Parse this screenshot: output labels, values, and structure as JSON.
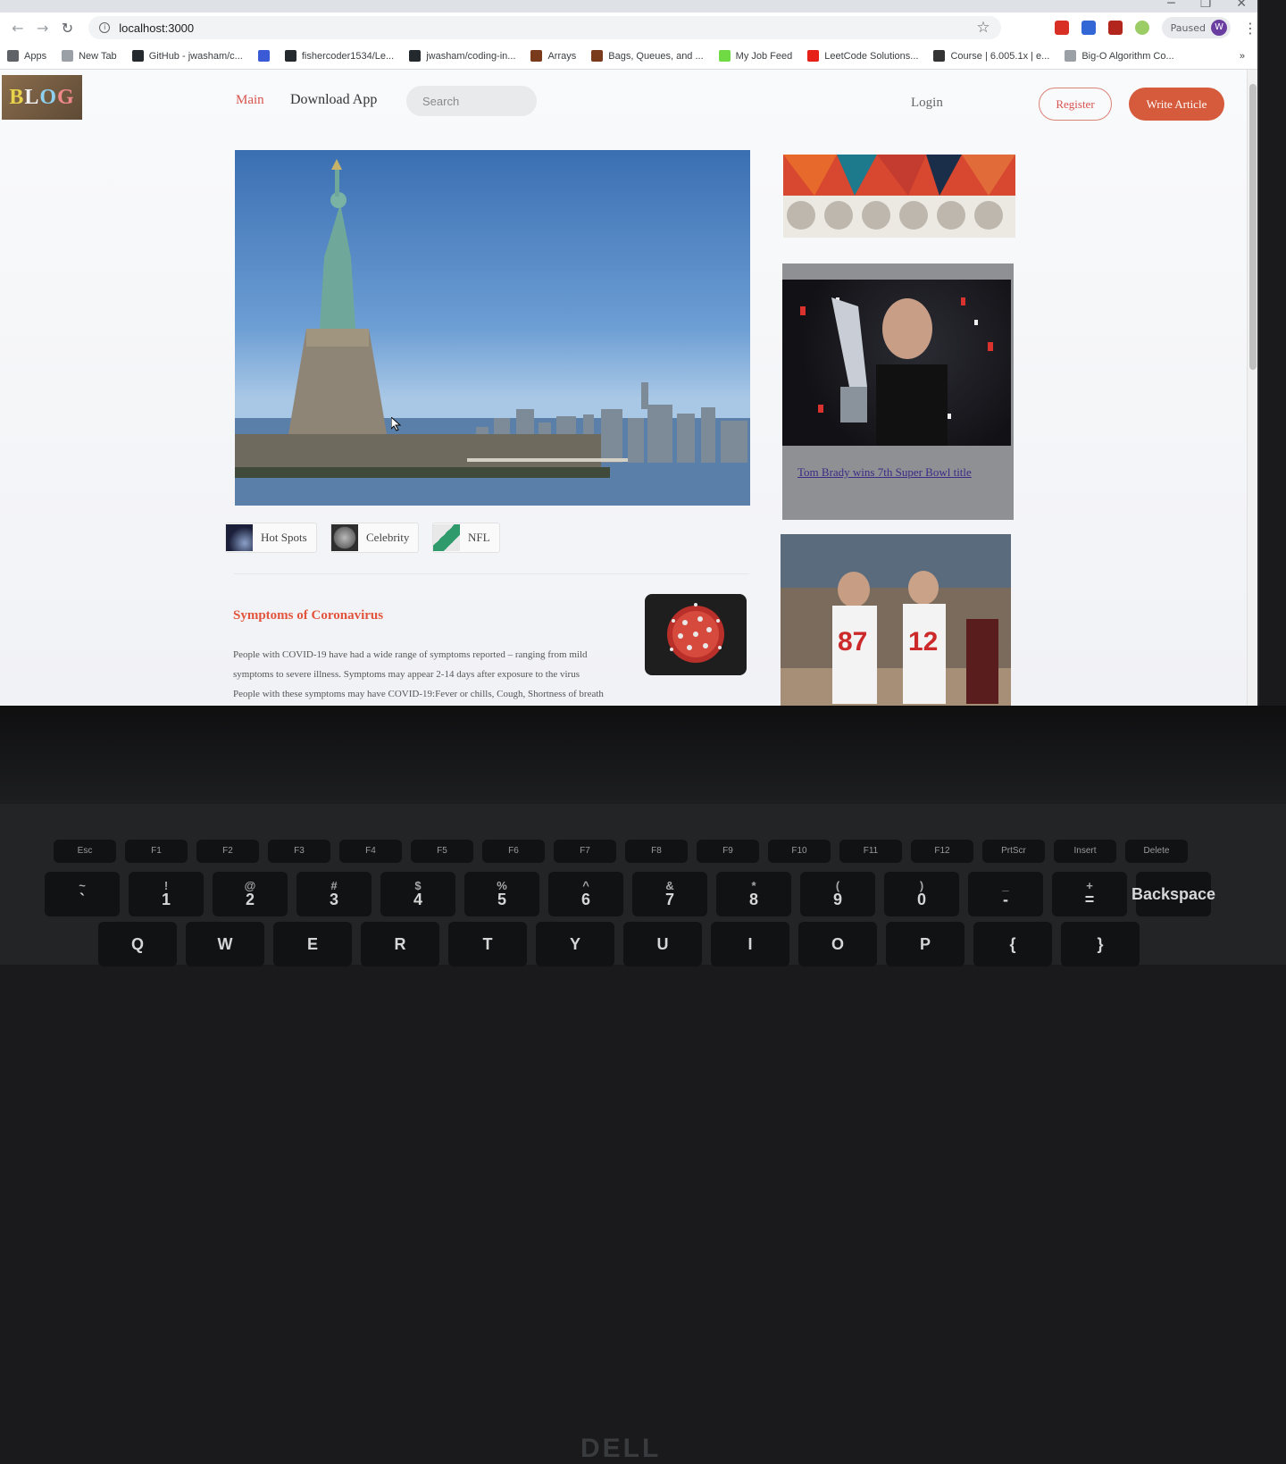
{
  "browser": {
    "url": "localhost:3000",
    "profile_label": "Paused",
    "profile_initial": "W",
    "bookmarks": [
      {
        "label": "Apps",
        "color": "#5f6368"
      },
      {
        "label": "New Tab",
        "color": "#9aa0a6"
      },
      {
        "label": "GitHub - jwasham/c...",
        "color": "#24292e"
      },
      {
        "label": "",
        "color": "#3b5bd6"
      },
      {
        "label": "fishercoder1534/Le...",
        "color": "#24292e"
      },
      {
        "label": "jwasham/coding-in...",
        "color": "#24292e"
      },
      {
        "label": "Arrays",
        "color": "#7a3b1c"
      },
      {
        "label": "Bags, Queues, and ...",
        "color": "#7a3b1c"
      },
      {
        "label": "My Job Feed",
        "color": "#6fda44"
      },
      {
        "label": "LeetCode Solutions...",
        "color": "#e62117"
      },
      {
        "label": "Course | 6.005.1x | e...",
        "color": "#333333"
      },
      {
        "label": "Big-O Algorithm Co...",
        "color": "#9aa0a6"
      }
    ],
    "overflow": "»"
  },
  "site": {
    "logo_letters": [
      "B",
      "L",
      "O",
      "G"
    ],
    "nav": {
      "main": "Main",
      "download": "Download App"
    },
    "search_placeholder": "Search",
    "login": "Login",
    "register": "Register",
    "write_article": "Write Article"
  },
  "categories": [
    {
      "label": "Hot Spots"
    },
    {
      "label": "Celebrity"
    },
    {
      "label": "NFL"
    }
  ],
  "article": {
    "title": "Symptoms of Coronavirus",
    "body_lines": [
      "People with COVID-19 have had a wide range of symptoms reported – ranging from mild",
      "symptoms to severe illness. Symptoms may appear 2-14 days after exposure to the virus",
      "People with these symptoms may have COVID-19:Fever or chills, Cough, Shortness of breath"
    ]
  },
  "sidebar": {
    "card1_link": "Tom Brady wins 7th Super Bowl title",
    "jersey_numbers": [
      "87",
      "12"
    ]
  },
  "keyboard": {
    "fn_row": [
      "Esc",
      "F1",
      "F2",
      "F3",
      "F4",
      "F5",
      "F6",
      "F7",
      "F8",
      "F9",
      "F10",
      "F11",
      "F12",
      "PrtScr",
      "Insert",
      "Delete"
    ],
    "number_row": [
      [
        "~",
        "`"
      ],
      [
        "!",
        "1"
      ],
      [
        "@",
        "2"
      ],
      [
        "#",
        "3"
      ],
      [
        "$",
        "4"
      ],
      [
        "%",
        "5"
      ],
      [
        "^",
        "6"
      ],
      [
        "&",
        "7"
      ],
      [
        "*",
        "8"
      ],
      [
        "(",
        "9"
      ],
      [
        ")",
        "0"
      ],
      [
        "_",
        "-"
      ],
      [
        "+",
        "="
      ],
      [
        "",
        "Backspace"
      ]
    ],
    "letter_row": [
      "Q",
      "W",
      "E",
      "R",
      "T",
      "Y",
      "U",
      "I",
      "O",
      "P",
      "{",
      "}"
    ],
    "brand": "DELL"
  },
  "colors": {
    "accent": "#d65a3c",
    "title": "#e2543c",
    "link": "#3b2a86"
  }
}
